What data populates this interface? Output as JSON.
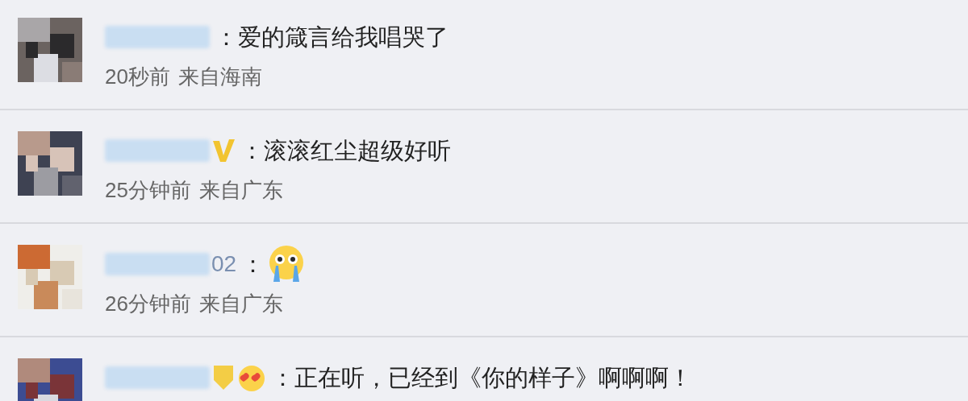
{
  "comments": [
    {
      "text": "：爱的箴言给我唱哭了",
      "time": "20秒前",
      "location": "来自海南"
    },
    {
      "badges": [
        {
          "kind": "verified"
        }
      ],
      "text": "：滚滚红尘超级好听",
      "time": "25分钟前",
      "location": "来自广东"
    },
    {
      "name_tail": "02",
      "text": "：",
      "emojis": [
        {
          "kind": "crying"
        }
      ],
      "time": "26分钟前",
      "location": "来自广东"
    },
    {
      "badges": [
        {
          "kind": "medal"
        },
        {
          "kind": "heart-eyes"
        }
      ],
      "text": "：正在听，已经到《你的样子》啊啊啊！"
    }
  ]
}
